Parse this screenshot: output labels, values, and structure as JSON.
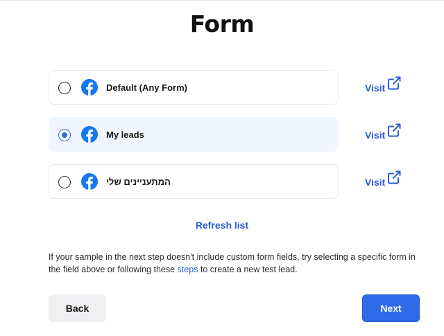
{
  "page": {
    "title": "Form"
  },
  "options": [
    {
      "label": "Default (Any Form)",
      "selected": false,
      "visit_label": "Visit"
    },
    {
      "label": "My leads",
      "selected": true,
      "visit_label": "Visit"
    },
    {
      "label": "המתעניינים שלי",
      "selected": false,
      "visit_label": "Visit"
    }
  ],
  "refresh_label": "Refresh list",
  "note": {
    "before": "If your sample in the next step doesn't include custom form fields, try selecting a specific form in the field above or following these ",
    "link": "steps",
    "after": " to create a new test lead."
  },
  "buttons": {
    "back": "Back",
    "next": "Next"
  },
  "icons": {
    "brand": "facebook-icon",
    "external": "external-link-icon"
  },
  "colors": {
    "accent": "#2f6ae8",
    "link": "#2a5bd7",
    "selected_bg": "#f0f5ff",
    "facebook": "#1877f2"
  }
}
